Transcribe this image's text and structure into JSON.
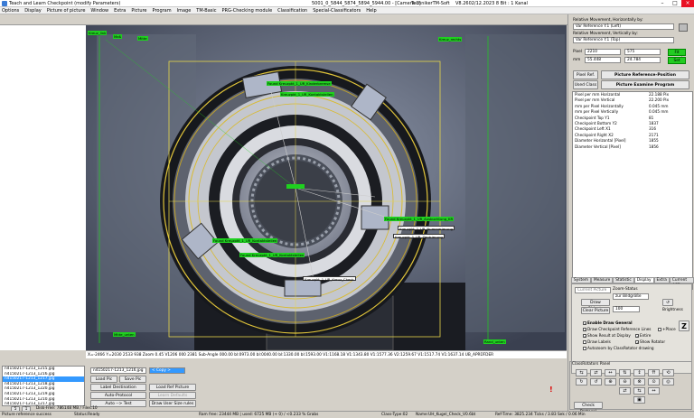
{
  "title": {
    "left": "Teach and Learn Checkpoint (modify Parameters)",
    "middle": "5001_0_5844_5874_5894_5944.00 - [Camera 1]",
    "right_app": "TechnikerTM-Soft",
    "version": "V8.2602/12.2023 8 Bit : 1 Kanal"
  },
  "menu": [
    "Options",
    "Display",
    "Picture of picture",
    "Window",
    "Extra",
    "Picture",
    "Program",
    "Image",
    "TM-Basic",
    "PRG-Checking module",
    "Classification",
    "Special-Classificators",
    "Help"
  ],
  "viewer_labels": [
    {
      "text": "Found Kreuzpkt_1_UR_Kinderbremse",
      "cls": "lbl"
    },
    {
      "text": "Kreuzpkt_1_UR_Kontaktstellen",
      "cls": "lbl"
    },
    {
      "text": "Found Kreuzpkt_1_UR_Ausbuchtung_KR",
      "cls": "lbl"
    },
    {
      "text": "Kreuzpkt_1_UR_Nummerierung",
      "cls": "lblw"
    },
    {
      "text": "Kreuzpkt_1_UR_Zentrierung",
      "cls": "lblw"
    },
    {
      "text": "Found Kreuzpkt_1_UR_Kontaktstellen",
      "cls": "lbl"
    },
    {
      "text": "Found Kreuzpkt_1_UR_Kontaktstellen",
      "cls": "lbl"
    },
    {
      "text": "Kreuzpkt_1_UR_Kreuz_Check",
      "cls": "lblw"
    }
  ],
  "corner_labels": [
    "Kreuz_link",
    "Maß",
    "Mitte",
    "Kreuz_rechts",
    "Mitte_unten",
    "Rand_unten"
  ],
  "infobar": "X=-2466 Y=2030    2533 938   Zoom 0.45    V1206 000 2381    Sub-Angle 000.00   bl:0973.00  bl:0040.00   bl:1330.00  bl:1593.00   V1:1168.18  V1:1343.80   V1:1577.36  V2:1259.67  V1:1517.74  V1:1637.14    UB_APRÜFDER",
  "right": {
    "rel_h_label": "Relative Movement, Horizontally by:",
    "rel_h_value": "Var Reference Y.1 (Left)",
    "rel_v_label": "Relative Movement, Vertically by:",
    "rel_v_value": "Var Reference Y.1 (Top)",
    "pixel_label": "Pixel",
    "pixel_x": "2210",
    "pixel_y": "575",
    "mm_label": "mm",
    "mm_x": "55.448",
    "mm_y": "24.784",
    "fit_btn": "Fit equal",
    "set_btn": "Set",
    "pixel_ref_btn": "Pixel Ref.",
    "pixel_ref_pos_btn": "Picture Reference-Position",
    "used_class_btn": "Used Class",
    "examine_btn": "Picture Examine Program",
    "params": [
      [
        "Pixel per mm Horizontal",
        "22.188 Pix"
      ],
      [
        "Pixel per mm Vertical",
        "22.200 Pix"
      ],
      [
        "mm per Pixel Horizontally",
        "0.045 mm"
      ],
      [
        "mm per Pixel Vertically",
        "0.045 mm"
      ],
      [
        "Checkpoint Top Y1",
        "81"
      ],
      [
        "Checkpoint Bottom Y2",
        "1837"
      ],
      [
        "Checkpoint Left X1",
        "316"
      ],
      [
        "Checkpoint Right X2",
        "2171"
      ],
      [
        "Diameter Horizontal [Pixel]",
        "1855"
      ],
      [
        "Diameter Vertical [Pixel]",
        "1856"
      ]
    ],
    "tabs": [
      "System",
      "Measure",
      "Statistic",
      "Display",
      "Extra",
      "Current ACE"
    ],
    "mode_select": "Current Picture",
    "zoom_label": "Zoom-Status",
    "zoom_select": "zur Bildgröße",
    "draw_objects_btn": "Draw Objects",
    "clear_picture_btn": "Clear Picture",
    "brightness_label": "Brightness",
    "brightness_value": "100",
    "checks": [
      "Enable Draw General",
      "Draw Checkpoint Reference Lines",
      "Show Result at Display",
      "Draw Labels",
      "Autozoom by ClassRotator drawing",
      "Entire",
      "Show Rotator",
      "+Place"
    ],
    "cfp_title": "ClassRotators Panel",
    "check_protocol": "Check Protocol"
  },
  "bottom": {
    "files": [
      "n4150217-1213_1215.jpg",
      "n4150217-1213_1216.jpg",
      "n4150217-1213_1217.jpg",
      "n4150217-1213_1218.jpg",
      "n4150217-1213_1220.jpg",
      "n4150217-1213_1219.jpg",
      "n4150217-1213_1210.jpg",
      "n4150217-1213_1217.jpg"
    ],
    "current_file": "n4150217-1213_1216.jpg",
    "copy_file": "< Copy >",
    "load_pic": "Load Pic",
    "save_pic": "Save Pic",
    "label_dest": "Label Destination",
    "load_ref": "Load Ref Picture",
    "auto_protocol": "Auto-Protocol",
    "learn_ref": "Learn Defaults",
    "auto_test": "Auto --> Test",
    "draw_user": "Draw User Size rules",
    "nav": [
      "5",
      "1"
    ],
    "dark_label": "Disk-Free: 786148 MB / Files:10"
  },
  "status": {
    "left": "Picture reference success",
    "status": "Status:Ready",
    "mem": "Ram free: 23444 MB | used: 6725 MB (+ 0) / <0.233 % Grabs",
    "class": "Class-Type:02",
    "name": "Name:UH_Kugel_Check_V0.6bt",
    "time": "Ref-Time: 3825.234 Ticks / 3.83 Sek / 0.06 Min"
  }
}
